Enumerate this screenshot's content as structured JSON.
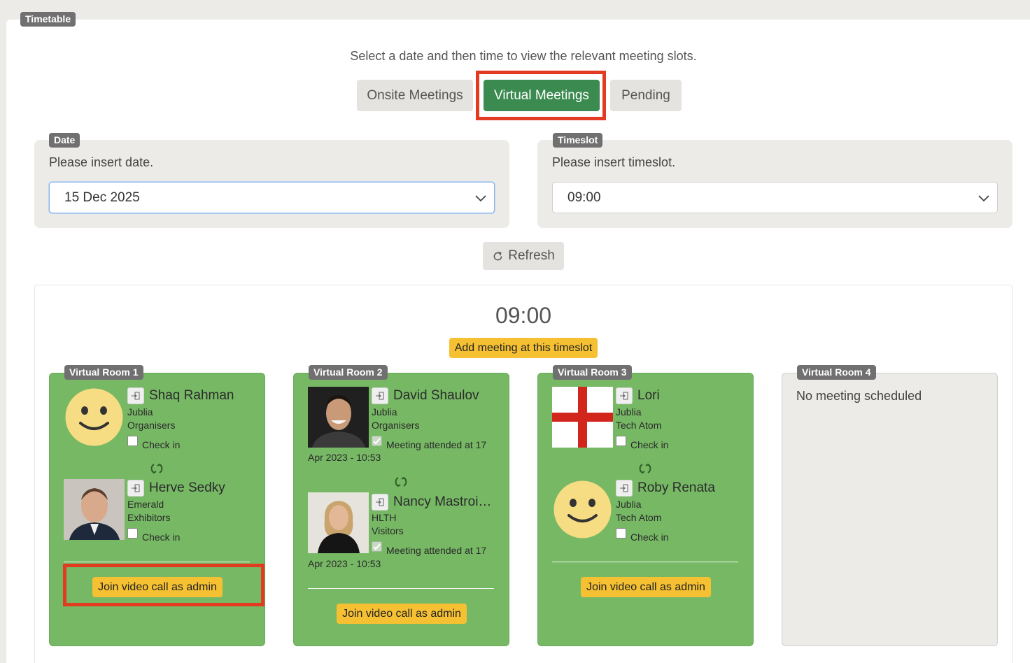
{
  "page": {
    "tag": "Timetable",
    "intro": "Select a date and then time to view the relevant meeting slots."
  },
  "tabs": {
    "onsite": "Onsite Meetings",
    "virtual": "Virtual Meetings",
    "pending": "Pending",
    "active": "virtual"
  },
  "date_field": {
    "tag": "Date",
    "help": "Please insert date.",
    "value": "15 Dec 2025"
  },
  "timeslot_field": {
    "tag": "Timeslot",
    "help": "Please insert timeslot.",
    "value": "09:00"
  },
  "refresh": {
    "label": "Refresh"
  },
  "slot": {
    "time": "09:00",
    "add_label": "Add meeting at this timeslot"
  },
  "rooms": [
    {
      "tag": "Virtual Room 1",
      "persons": [
        {
          "name": "Shaq Rahman",
          "company": "Jublia",
          "group": "Organisers",
          "status": "Check in",
          "avatar": "smiley-icon"
        },
        {
          "name": "Herve Sedky",
          "company": "Emerald",
          "group": "Exhibitors",
          "status": "Check in",
          "avatar": "photo"
        }
      ],
      "join_label": "Join video call as admin"
    },
    {
      "tag": "Virtual Room 2",
      "persons": [
        {
          "name": "David Shaulov",
          "company": "Jublia",
          "group": "Organisers",
          "status_a": "Meeting attended at 17",
          "status_b": "Apr 2023 - 10:53",
          "avatar": "photo"
        },
        {
          "name": "Nancy Mastroi…",
          "company": "HLTH",
          "group": "Visitors",
          "status_a": "Meeting attended at 17",
          "status_b": "Apr 2023 - 10:53",
          "avatar": "photo"
        }
      ],
      "join_label": "Join video call as admin"
    },
    {
      "tag": "Virtual Room 3",
      "persons": [
        {
          "name": "Lori",
          "company": "Jublia",
          "group": "Tech Atom",
          "status": "Check in",
          "avatar": "england-flag-icon"
        },
        {
          "name": "Roby Renata",
          "company": "Jublia",
          "group": "Tech Atom",
          "status": "Check in",
          "avatar": "smiley-icon"
        }
      ],
      "join_label": "Join video call as admin"
    },
    {
      "tag": "Virtual Room 4",
      "empty_label": "No meeting scheduled"
    }
  ],
  "colors": {
    "active_tab": "#3b8a50",
    "room_green": "#77b865",
    "accent_yellow": "#f5c032",
    "highlight_red": "#e33a22"
  }
}
